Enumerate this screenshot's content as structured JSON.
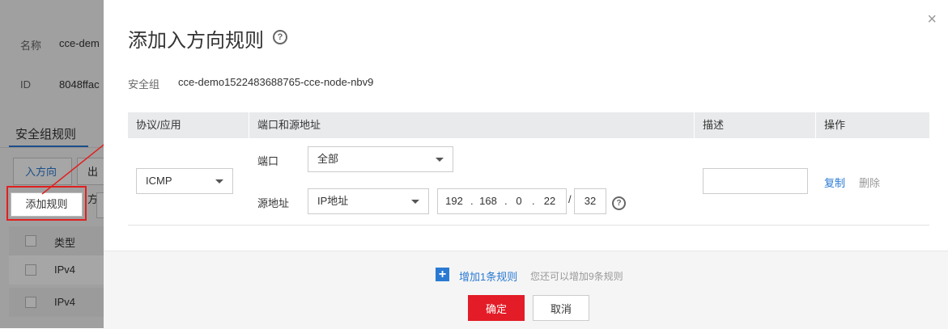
{
  "background": {
    "name_label": "名称",
    "name_value": "cce-dem",
    "id_label": "ID",
    "id_value": "8048ffac",
    "tab_title": "安全组规则",
    "subtab_in": "入方向",
    "subtab_out": "出方",
    "add_rule_button": "添加规则",
    "table_header_type": "类型",
    "rows": [
      "IPv4",
      "IPv4"
    ]
  },
  "dialog": {
    "title": "添加入方向规则",
    "close_glyph": "×",
    "help_glyph": "?",
    "security_group_label": "安全组",
    "security_group_value": "cce-demo1522483688765-cce-node-nbv9",
    "columns": {
      "protocol": "协议/应用",
      "port_source": "端口和源地址",
      "description": "描述",
      "action": "操作"
    },
    "rule": {
      "protocol_value": "ICMP",
      "port_label": "端口",
      "port_value": "全部",
      "source_label": "源地址",
      "source_type": "IP地址",
      "ip_octets": [
        "192",
        "168",
        "0",
        "22"
      ],
      "prefix": "32",
      "description_value": "",
      "copy_label": "复制",
      "delete_label": "删除"
    },
    "footer": {
      "add_icon": "+",
      "add_link": "增加1条规则",
      "add_hint": "您还可以增加9条规则",
      "ok_label": "确定",
      "cancel_label": "取消"
    }
  },
  "colors": {
    "accent": "#2a7ad3",
    "primary_button": "#e31c27",
    "annotation": "#e02020"
  }
}
